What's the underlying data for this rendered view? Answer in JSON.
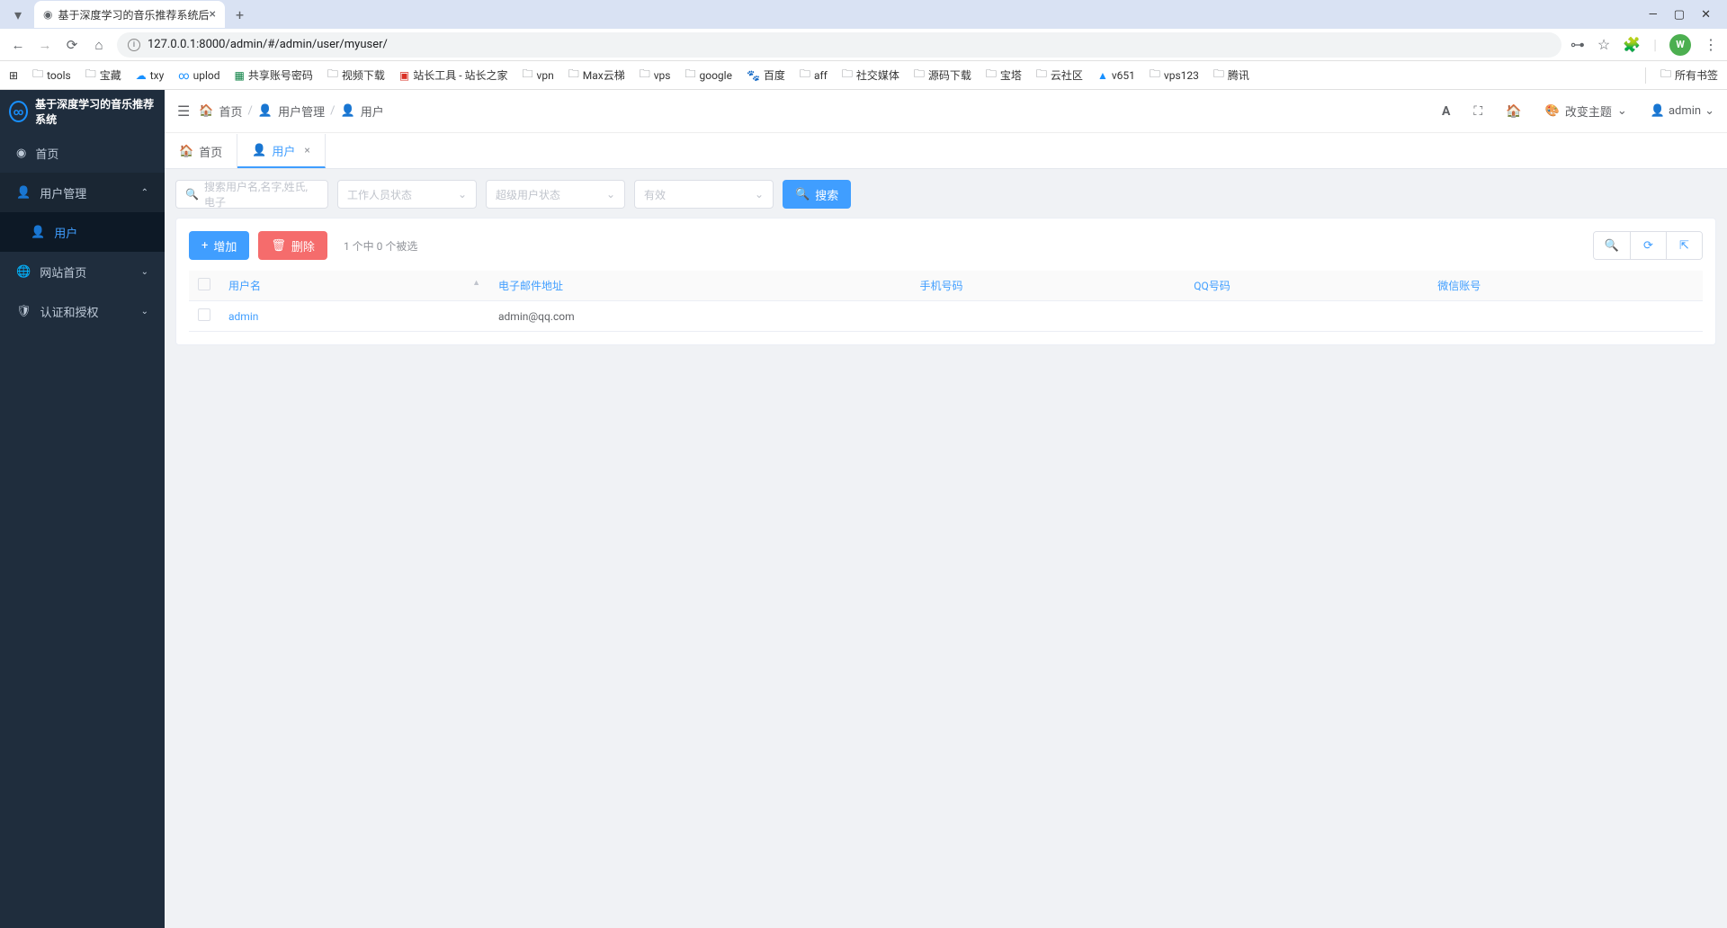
{
  "browser": {
    "tab_title": "基于深度学习的音乐推荐系统后",
    "url": "127.0.0.1:8000/admin/#/admin/user/myuser/",
    "avatar_letter": "W",
    "bookmarks": [
      "tools",
      "宝藏",
      "txy",
      "uplod",
      "共享账号密码",
      "视频下载",
      "站长工具 - 站长之家",
      "vpn",
      "Max云梯",
      "vps",
      "google",
      "百度",
      "aff",
      "社交媒体",
      "源码下载",
      "宝塔",
      "云社区",
      "v651",
      "vps123",
      "腾讯"
    ],
    "bookmark_all": "所有书签"
  },
  "app": {
    "logo_text": "基于深度学习的音乐推荐系统",
    "sidebar": {
      "home": "首页",
      "user_mgmt": "用户管理",
      "user": "用户",
      "site_home": "网站首页",
      "auth": "认证和授权"
    },
    "breadcrumb": {
      "home": "首页",
      "user_mgmt": "用户管理",
      "user": "用户"
    },
    "header": {
      "theme": "改变主题",
      "username": "admin"
    },
    "tabs": {
      "home": "首页",
      "user": "用户"
    },
    "filters": {
      "search_ph": "搜索用户名,名字,姓氏,电子",
      "staff_ph": "工作人员状态",
      "super_ph": "超级用户状态",
      "active_ph": "有效",
      "search_btn": "搜索"
    },
    "actions": {
      "add": "增加",
      "delete": "删除",
      "selection": "1 个中 0 个被选"
    },
    "table": {
      "cols": {
        "username": "用户名",
        "email": "电子邮件地址",
        "phone": "手机号码",
        "qq": "QQ号码",
        "wechat": "微信账号"
      },
      "rows": [
        {
          "username": "admin",
          "email": "admin@qq.com",
          "phone": "",
          "qq": "",
          "wechat": ""
        }
      ]
    }
  }
}
